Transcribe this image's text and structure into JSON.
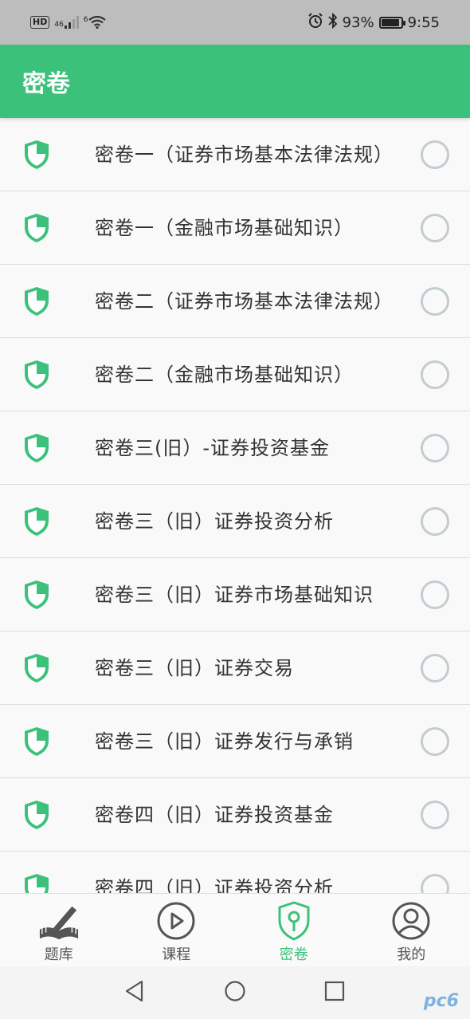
{
  "status_bar": {
    "hd": "HD",
    "network_1": "46",
    "network_2": "6",
    "battery": "93%",
    "battery_level": 0.93,
    "time": "9:55"
  },
  "app_bar": {
    "title": "密卷"
  },
  "papers": [
    {
      "title": "密卷一（证券市场基本法律法规）",
      "selected": false
    },
    {
      "title": "密卷一（金融市场基础知识）",
      "selected": false
    },
    {
      "title": "密卷二（证券市场基本法律法规）",
      "selected": false
    },
    {
      "title": "密卷二（金融市场基础知识）",
      "selected": false
    },
    {
      "title": "密卷三(旧）-证券投资基金",
      "selected": false
    },
    {
      "title": "密卷三（旧）证券投资分析",
      "selected": false
    },
    {
      "title": "密卷三（旧）证券市场基础知识",
      "selected": false
    },
    {
      "title": "密卷三（旧）证券交易",
      "selected": false
    },
    {
      "title": "密卷三（旧）证券发行与承销",
      "selected": false
    },
    {
      "title": "密卷四（旧）证券投资基金",
      "selected": false
    },
    {
      "title": "密卷四（旧）证券投资分析",
      "selected": false
    }
  ],
  "tabs": [
    {
      "label": "题库",
      "icon": "book-pen-icon",
      "active": false
    },
    {
      "label": "课程",
      "icon": "play-circle-icon",
      "active": false
    },
    {
      "label": "密卷",
      "icon": "shield-key-icon",
      "active": true
    },
    {
      "label": "我的",
      "icon": "user-circle-icon",
      "active": false
    }
  ],
  "colors": {
    "accent": "#3cc17b",
    "radio": "#c3ccd1",
    "text": "#333333"
  },
  "watermark": "pc6"
}
